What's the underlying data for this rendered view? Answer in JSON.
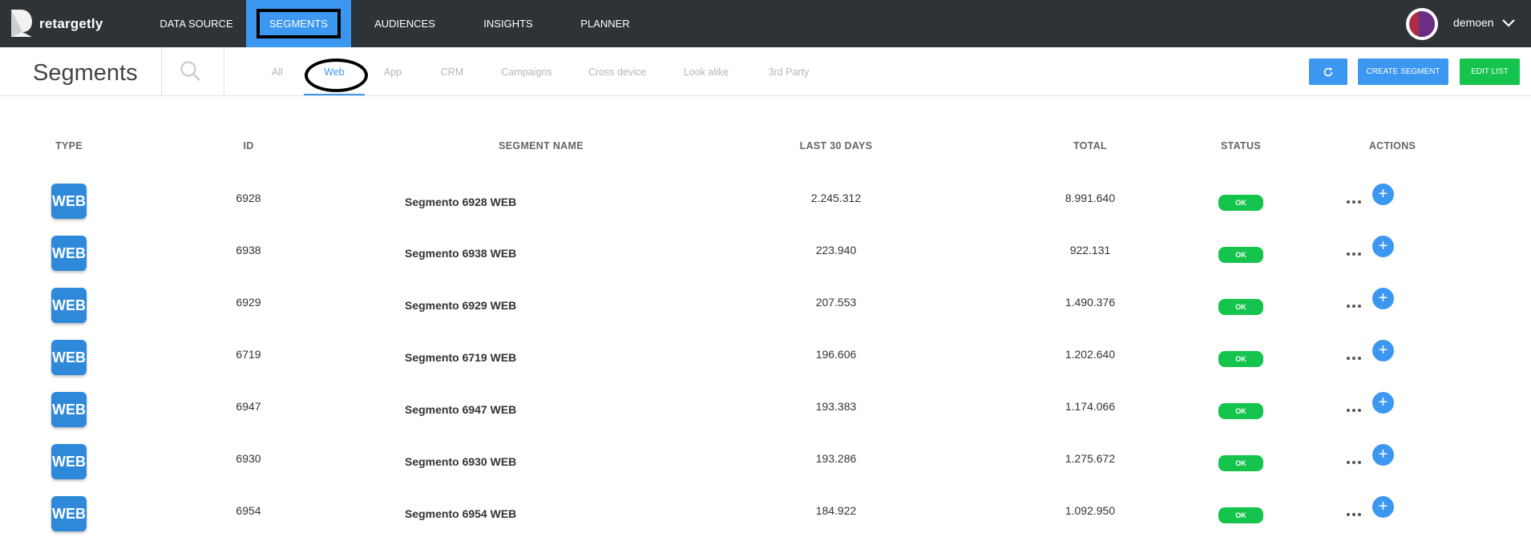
{
  "app": {
    "brand": "retargetly",
    "icons": {
      "logo": "retargetly-logo-icon",
      "search": "search-icon",
      "refresh": "refresh-icon",
      "more": "more-horizontal-icon",
      "add": "plus-icon",
      "chevron": "chevron-down-icon"
    }
  },
  "nav": {
    "items": [
      {
        "label": "DATA SOURCE"
      },
      {
        "label": "SEGMENTS"
      },
      {
        "label": "AUDIENCES"
      },
      {
        "label": "INSIGHTS"
      },
      {
        "label": "PLANNER"
      }
    ],
    "active": "SEGMENTS"
  },
  "user": {
    "name": "demoen"
  },
  "header": {
    "title": "Segments",
    "tabs": [
      {
        "label": "All"
      },
      {
        "label": "Web"
      },
      {
        "label": "App"
      },
      {
        "label": "CRM"
      },
      {
        "label": "Campaigns"
      },
      {
        "label": "Cross device"
      },
      {
        "label": "Look alike"
      },
      {
        "label": "3rd Party"
      }
    ],
    "active_tab": "Web",
    "create_label": "CREATE SEGMENT",
    "edit_label": "EDIT LIST"
  },
  "table": {
    "columns": [
      "TYPE",
      "ID",
      "SEGMENT NAME",
      "LAST 30 DAYS",
      "TOTAL",
      "STATUS",
      "ACTIONS"
    ],
    "rows": [
      {
        "type": "WEB",
        "id": "6928",
        "name": "Segmento 6928 WEB",
        "last30": "2.245.312",
        "total": "8.991.640",
        "status": "OK"
      },
      {
        "type": "WEB",
        "id": "6938",
        "name": "Segmento 6938 WEB",
        "last30": "223.940",
        "total": "922.131",
        "status": "OK"
      },
      {
        "type": "WEB",
        "id": "6929",
        "name": "Segmento 6929 WEB",
        "last30": "207.553",
        "total": "1.490.376",
        "status": "OK"
      },
      {
        "type": "WEB",
        "id": "6719",
        "name": "Segmento 6719 WEB",
        "last30": "196.606",
        "total": "1.202.640",
        "status": "OK"
      },
      {
        "type": "WEB",
        "id": "6947",
        "name": "Segmento 6947 WEB",
        "last30": "193.383",
        "total": "1.174.066",
        "status": "OK"
      },
      {
        "type": "WEB",
        "id": "6930",
        "name": "Segmento 6930 WEB",
        "last30": "193.286",
        "total": "1.275.672",
        "status": "OK"
      },
      {
        "type": "WEB",
        "id": "6954",
        "name": "Segmento 6954 WEB",
        "last30": "184.922",
        "total": "1.092.950",
        "status": "OK"
      }
    ]
  },
  "colors": {
    "accent": "#3c97f0",
    "topbar": "#2e3338",
    "success": "#15c44c",
    "type_badge": "#2f89db"
  }
}
